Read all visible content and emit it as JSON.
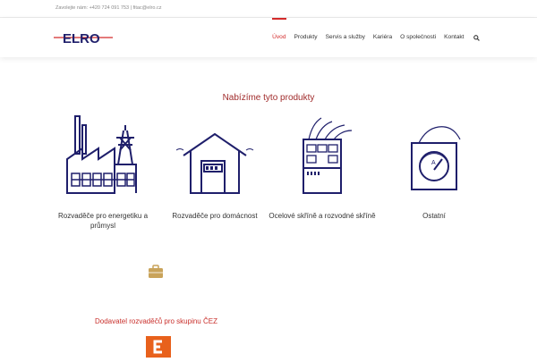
{
  "topbar": {
    "contact_text": "Zavolejte nám: +420 724 091 753  |  fitac@elro.cz"
  },
  "header": {
    "logo_text": "ELRO",
    "nav": [
      {
        "label": "Úvod",
        "active": true
      },
      {
        "label": "Produkty",
        "active": false
      },
      {
        "label": "Servis a služby",
        "active": false
      },
      {
        "label": "Kariéra",
        "active": false
      },
      {
        "label": "O společnosti",
        "active": false
      },
      {
        "label": "Kontakt",
        "active": false
      }
    ],
    "search_icon": "search-icon"
  },
  "main": {
    "section_title": "Nabízíme tyto produkty",
    "products": [
      {
        "label": "Rozvaděče pro energetiku a průmysl",
        "icon": "factory-icon"
      },
      {
        "label": "Rozvaděče pro domácnost",
        "icon": "house-icon"
      },
      {
        "label": "Ocelové skříně a rozvodné skříně",
        "icon": "cabinet-icon"
      },
      {
        "label": "Ostatní",
        "icon": "meter-icon"
      }
    ],
    "supplier_text": "Dodavatel rozvaděčů pro skupinu ČEZ",
    "supplier_logo_icon": "cez-logo-icon",
    "case_icon": "briefcase-icon"
  },
  "colors": {
    "accent_red": "#d32a2a",
    "navy": "#1f1f6b",
    "title_red": "#a02b2b",
    "cez_orange": "#e8611c"
  }
}
